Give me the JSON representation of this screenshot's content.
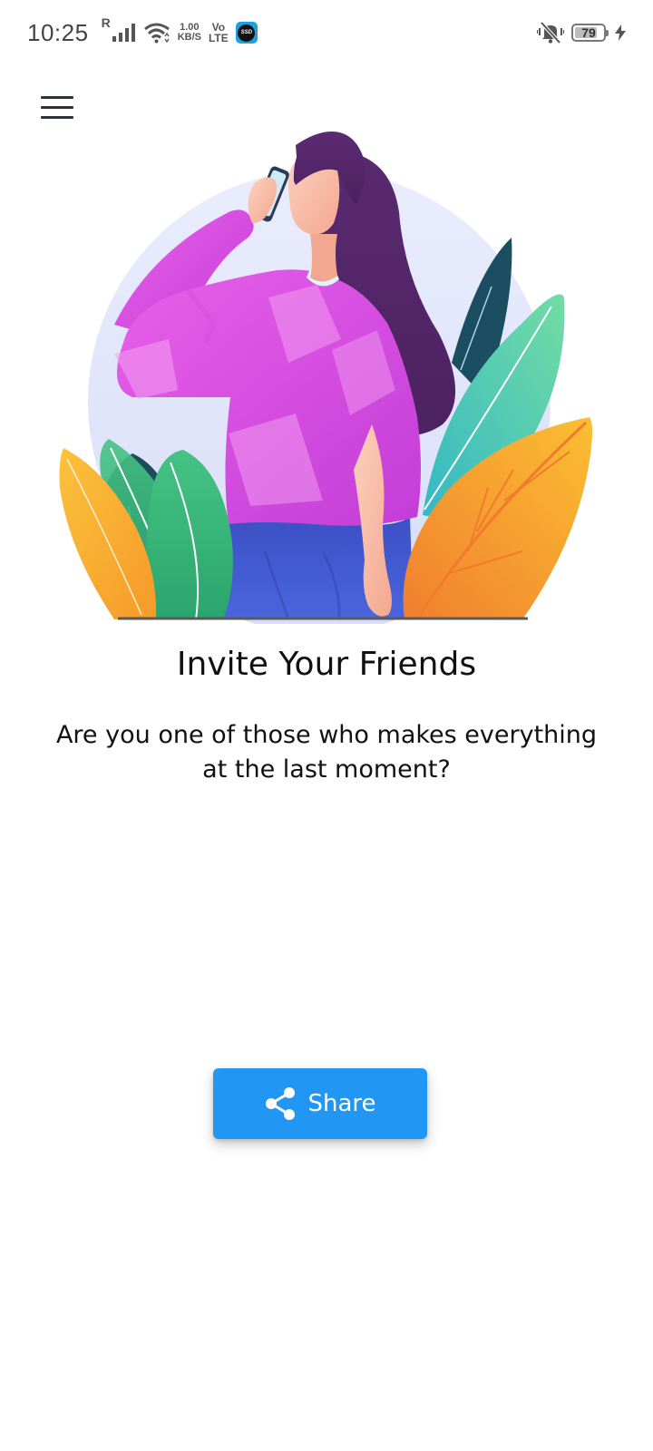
{
  "status_bar": {
    "time": "10:25",
    "roaming": "R",
    "speed_value": "1.00",
    "speed_unit": "KB/S",
    "volte_top": "Vo",
    "volte_bottom": "LTE",
    "app_badge": "SSD",
    "battery_level": "79",
    "battery_fraction": 0.79,
    "icons": [
      "signal-icon",
      "wifi-icon",
      "ssd-app-icon",
      "vibrate-icon",
      "battery-icon",
      "charging-icon"
    ]
  },
  "app_bar": {
    "menu_icon": "hamburger-menu-icon"
  },
  "illustration": {
    "subject": "woman-on-phone-illustration"
  },
  "content": {
    "title": "Invite Your Friends",
    "subtitle": "Are you one of those who makes everything at the last moment?"
  },
  "share_button": {
    "label": "Share",
    "icon": "share-icon",
    "color": "#2196F3"
  },
  "colors": {
    "background": "#FFFFFF",
    "accent": "#2196F3",
    "text": "#111111"
  }
}
